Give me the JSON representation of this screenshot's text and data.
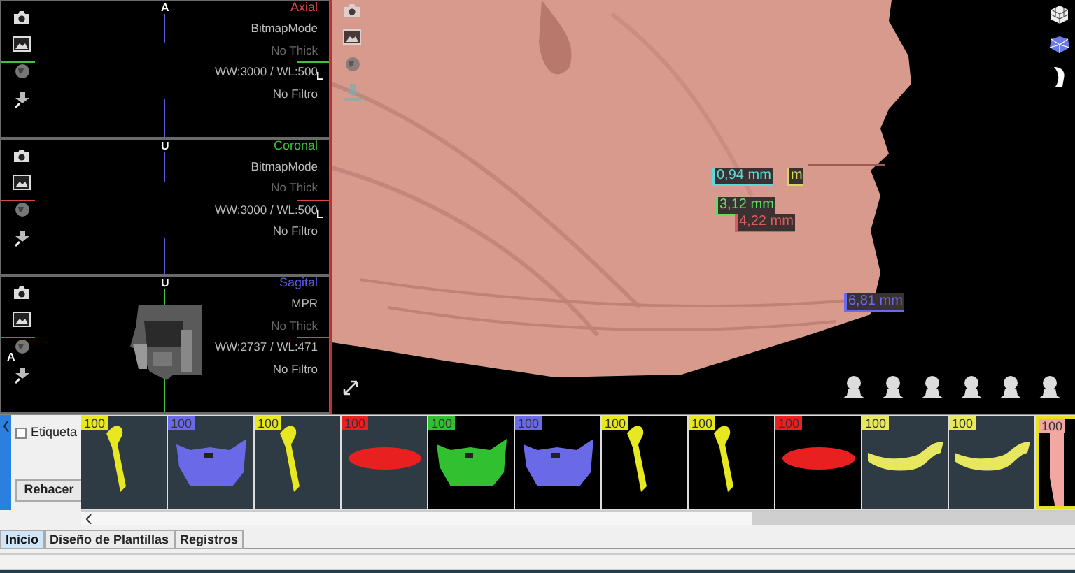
{
  "slice_views": [
    {
      "title": "Axial",
      "color": "#e04545",
      "markers": {
        "top": "A",
        "right": "L"
      },
      "picture": false,
      "lines": [
        {
          "text": "BitmapMode",
          "dim": false
        },
        {
          "text": "No Thick",
          "dim": true
        },
        {
          "text": "WW:3000 / WL:500",
          "dim": false
        },
        {
          "text": "No Filtro",
          "dim": false
        }
      ]
    },
    {
      "title": "Coronal",
      "color": "#3fc03f",
      "markers": {
        "top": "U",
        "right": "L"
      },
      "picture": false,
      "lines": [
        {
          "text": "BitmapMode",
          "dim": false
        },
        {
          "text": "No Thick",
          "dim": true
        },
        {
          "text": "WW:3000 / WL:500",
          "dim": false
        },
        {
          "text": "No Filtro",
          "dim": false
        }
      ]
    },
    {
      "title": "Sagital",
      "color": "#5a5ae0",
      "markers": {
        "top": "U",
        "left": "A"
      },
      "picture": true,
      "lines": [
        {
          "text": "MPR",
          "dim": false
        },
        {
          "text": "No Thick",
          "dim": true
        },
        {
          "text": "WW:2737 / WL:471",
          "dim": false
        },
        {
          "text": "No Filtro",
          "dim": false
        }
      ]
    }
  ],
  "measurements": [
    {
      "text": "0,94 mm",
      "color": "#5ed8d8"
    },
    {
      "text": "m",
      "color": "#d8d860"
    },
    {
      "text": "3,12 mm",
      "color": "#5ee05e"
    },
    {
      "text": "4,22 mm",
      "color": "#e05a5a"
    },
    {
      "text": "6,81 mm",
      "color": "#6a6af0"
    }
  ],
  "label_checkbox": {
    "label": "Etiqueta",
    "checked": false
  },
  "redo_button": "Rehacer",
  "thumbnails": [
    {
      "badge": "100",
      "color": "#e8e820",
      "kind": "bone",
      "active": true,
      "selected": false
    },
    {
      "badge": "100",
      "color": "#6a6ae8",
      "kind": "arch",
      "active": true,
      "selected": false
    },
    {
      "badge": "100",
      "color": "#e8e820",
      "kind": "bone",
      "active": true,
      "selected": false
    },
    {
      "badge": "100",
      "color": "#e82020",
      "kind": "lens",
      "active": true,
      "selected": false
    },
    {
      "badge": "100",
      "color": "#30c030",
      "kind": "arch",
      "active": false,
      "selected": false
    },
    {
      "badge": "100",
      "color": "#6a6ae8",
      "kind": "arch",
      "active": false,
      "selected": false
    },
    {
      "badge": "100",
      "color": "#e8e820",
      "kind": "bone",
      "active": false,
      "selected": false
    },
    {
      "badge": "100",
      "color": "#e8e820",
      "kind": "bone",
      "active": false,
      "selected": false
    },
    {
      "badge": "100",
      "color": "#e82020",
      "kind": "lens",
      "active": false,
      "selected": false
    },
    {
      "badge": "100",
      "color": "#e8e860",
      "kind": "jaw",
      "active": true,
      "selected": false
    },
    {
      "badge": "100",
      "color": "#e8e860",
      "kind": "jaw",
      "active": true,
      "selected": false
    },
    {
      "badge": "100",
      "color": "#f0a8a0",
      "kind": "skin",
      "active": false,
      "selected": true
    }
  ],
  "tabs": [
    {
      "label": "Inicio",
      "selected": true
    },
    {
      "label": "Diseño de Plantillas",
      "selected": false
    },
    {
      "label": "Registros",
      "selected": false
    }
  ]
}
